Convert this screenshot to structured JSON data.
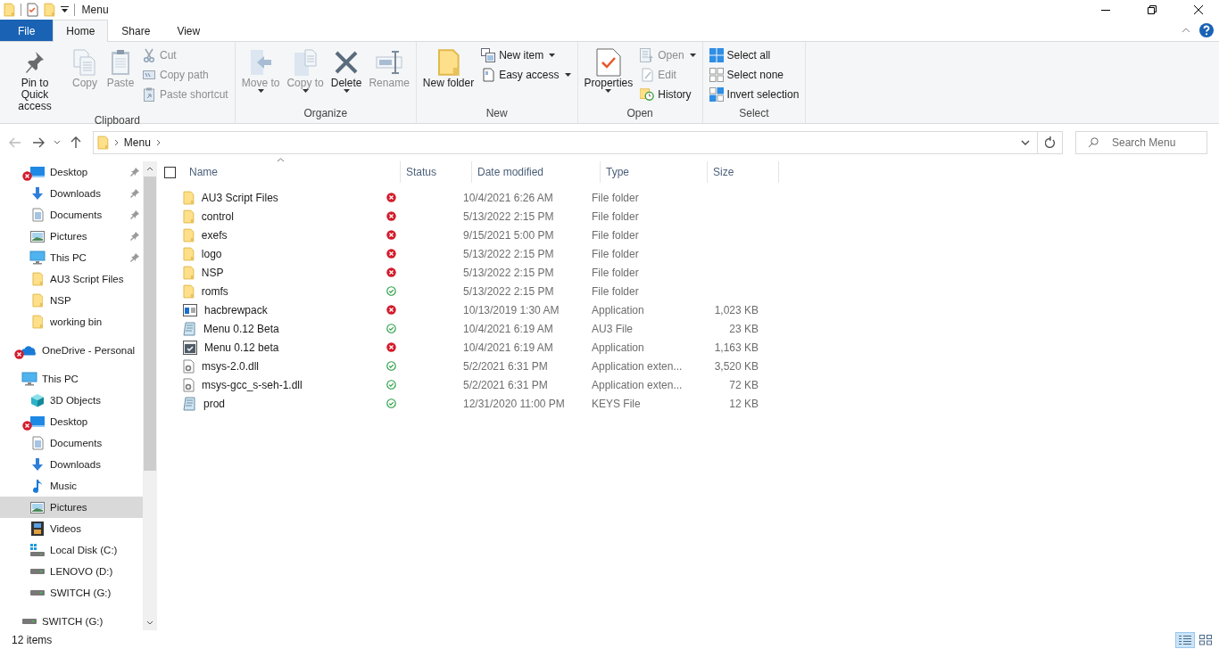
{
  "window": {
    "title": "Menu"
  },
  "ribbon_tabs": [
    {
      "label": "File",
      "kind": "file",
      "selected": false
    },
    {
      "label": "Home",
      "kind": "tab",
      "selected": true
    },
    {
      "label": "Share",
      "kind": "tab",
      "selected": false
    },
    {
      "label": "View",
      "kind": "tab",
      "selected": false
    }
  ],
  "ribbon_groups": [
    {
      "label": "Clipboard",
      "items": [
        {
          "kind": "large",
          "label": "Pin to Quick access",
          "disabled": false,
          "caret": false
        },
        {
          "kind": "large",
          "label": "Copy",
          "disabled": true,
          "caret": false
        },
        {
          "kind": "large",
          "label": "Paste",
          "disabled": true,
          "caret": false
        },
        {
          "kind": "small",
          "label": "Cut",
          "disabled": true,
          "caret": false
        },
        {
          "kind": "small",
          "label": "Copy path",
          "disabled": true,
          "caret": false
        },
        {
          "kind": "small",
          "label": "Paste shortcut",
          "disabled": true,
          "caret": false
        }
      ]
    },
    {
      "label": "Organize",
      "items": [
        {
          "kind": "large",
          "label": "Move to",
          "disabled": true,
          "caret": true
        },
        {
          "kind": "large",
          "label": "Copy to",
          "disabled": true,
          "caret": true
        },
        {
          "kind": "large",
          "label": "Delete",
          "disabled": false,
          "caret": true
        },
        {
          "kind": "large",
          "label": "Rename",
          "disabled": true,
          "caret": false
        }
      ]
    },
    {
      "label": "New",
      "items": [
        {
          "kind": "large",
          "label": "New folder",
          "disabled": false,
          "caret": false
        },
        {
          "kind": "small",
          "label": "New item",
          "disabled": false,
          "caret": true
        },
        {
          "kind": "small",
          "label": "Easy access",
          "disabled": false,
          "caret": true
        }
      ]
    },
    {
      "label": "Open",
      "items": [
        {
          "kind": "large",
          "label": "Properties",
          "disabled": false,
          "caret": true
        },
        {
          "kind": "small",
          "label": "Open",
          "disabled": true,
          "caret": true
        },
        {
          "kind": "small",
          "label": "Edit",
          "disabled": true,
          "caret": false
        },
        {
          "kind": "small",
          "label": "History",
          "disabled": false,
          "caret": false
        }
      ]
    },
    {
      "label": "Select",
      "items": [
        {
          "kind": "small",
          "label": "Select all",
          "disabled": false,
          "caret": false
        },
        {
          "kind": "small",
          "label": "Select none",
          "disabled": false,
          "caret": false
        },
        {
          "kind": "small",
          "label": "Invert selection",
          "disabled": false,
          "caret": false
        }
      ]
    }
  ],
  "address": {
    "path": [
      "Menu"
    ]
  },
  "search": {
    "placeholder": "Search Menu"
  },
  "sidebar": {
    "quick_access": [
      {
        "label": "Desktop",
        "kind": "desktop",
        "pinned": true,
        "sync_error": true,
        "selected": false
      },
      {
        "label": "Downloads",
        "kind": "downloads",
        "pinned": true,
        "sync_error": false,
        "selected": false
      },
      {
        "label": "Documents",
        "kind": "documents",
        "pinned": true,
        "sync_error": false,
        "selected": false
      },
      {
        "label": "Pictures",
        "kind": "pictures",
        "pinned": true,
        "sync_error": false,
        "selected": false
      },
      {
        "label": "This PC",
        "kind": "pc",
        "pinned": true,
        "sync_error": false,
        "selected": false
      },
      {
        "label": "AU3 Script Files",
        "kind": "folder",
        "pinned": false,
        "sync_error": false,
        "selected": false
      },
      {
        "label": "NSP",
        "kind": "folder",
        "pinned": false,
        "sync_error": false,
        "selected": false
      },
      {
        "label": "working bin",
        "kind": "folder",
        "pinned": false,
        "sync_error": false,
        "selected": false
      }
    ],
    "items": [
      {
        "label": "OneDrive - Personal",
        "kind": "cloud",
        "sync_error": true,
        "selected": false
      },
      {
        "label": "This PC",
        "kind": "pc",
        "sync_error": false,
        "selected": false,
        "children": [
          {
            "label": "3D Objects",
            "kind": "cube",
            "sync_error": false,
            "selected": false
          },
          {
            "label": "Desktop",
            "kind": "desktop",
            "sync_error": true,
            "selected": false
          },
          {
            "label": "Documents",
            "kind": "documents",
            "sync_error": false,
            "selected": false
          },
          {
            "label": "Downloads",
            "kind": "downloads",
            "sync_error": false,
            "selected": false
          },
          {
            "label": "Music",
            "kind": "music",
            "sync_error": false,
            "selected": false
          },
          {
            "label": "Pictures",
            "kind": "pictures",
            "sync_error": false,
            "selected": true
          },
          {
            "label": "Videos",
            "kind": "videos",
            "sync_error": false,
            "selected": false
          },
          {
            "label": "Local Disk (C:)",
            "kind": "windisk",
            "sync_error": false,
            "selected": false
          },
          {
            "label": "LENOVO (D:)",
            "kind": "drive",
            "sync_error": false,
            "selected": false
          },
          {
            "label": "SWITCH (G:)",
            "kind": "drive",
            "sync_error": false,
            "selected": false
          }
        ]
      },
      {
        "label": "SWITCH (G:)",
        "kind": "drive",
        "sync_error": false,
        "selected": false
      }
    ]
  },
  "table": {
    "select_all_checked": false,
    "columns": [
      "Name",
      "Status",
      "Date modified",
      "Type",
      "Size"
    ],
    "rows": [
      {
        "name": "AU3 Script Files",
        "kind": "folder",
        "sync_error": true,
        "date": "10/4/2021 6:26 AM",
        "type": "File folder"
      },
      {
        "name": "control",
        "kind": "folder",
        "sync_error": true,
        "date": "5/13/2022 2:15 PM",
        "type": "File folder"
      },
      {
        "name": "exefs",
        "kind": "folder",
        "sync_error": true,
        "date": "9/15/2021 5:00 PM",
        "type": "File folder"
      },
      {
        "name": "logo",
        "kind": "folder",
        "sync_error": true,
        "date": "5/13/2022 2:15 PM",
        "type": "File folder"
      },
      {
        "name": "NSP",
        "kind": "folder",
        "sync_error": true,
        "date": "5/13/2022 2:15 PM",
        "type": "File folder"
      },
      {
        "name": "romfs",
        "kind": "folder",
        "sync_error": false,
        "date": "5/13/2022 2:15 PM",
        "type": "File folder"
      },
      {
        "name": "hacbrewpack",
        "kind": "window",
        "sync_error": true,
        "date": "10/13/2019 1:30 AM",
        "type": "Application",
        "size": "1,023 KB"
      },
      {
        "name": "Menu 0.12 Beta",
        "kind": "script",
        "sync_error": false,
        "date": "10/4/2021 6:19 AM",
        "type": "AU3 File",
        "size": "23 KB"
      },
      {
        "name": "Menu 0.12 beta",
        "kind": "app",
        "sync_error": true,
        "date": "10/4/2021 6:19 AM",
        "type": "Application",
        "size": "1,163 KB"
      },
      {
        "name": "msys-2.0.dll",
        "kind": "dll",
        "sync_error": false,
        "date": "5/2/2021 6:31 PM",
        "type": "Application exten...",
        "size": "3,520 KB"
      },
      {
        "name": "msys-gcc_s-seh-1.dll",
        "kind": "dll",
        "sync_error": false,
        "date": "5/2/2021 6:31 PM",
        "type": "Application exten...",
        "size": "72 KB"
      },
      {
        "name": "prod",
        "kind": "script",
        "sync_error": false,
        "date": "12/31/2020 11:00 PM",
        "type": "KEYS File",
        "size": "12 KB"
      }
    ]
  },
  "status_bar": {
    "count": "12 items",
    "views": [
      {
        "kind": "details",
        "selected": true
      },
      {
        "kind": "tiles",
        "selected": false
      }
    ]
  }
}
